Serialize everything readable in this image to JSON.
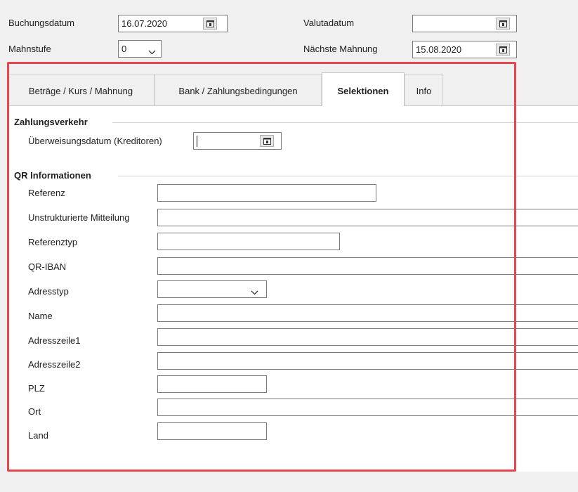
{
  "header": {
    "buchungsdatum_label": "Buchungsdatum",
    "buchungsdatum_value": "16.07.2020",
    "valutadatum_label": "Valutadatum",
    "valutadatum_value": "",
    "mahnstufe_label": "Mahnstufe",
    "mahnstufe_value": "0",
    "naechste_mahnung_label": "Nächste Mahnung",
    "naechste_mahnung_value": "15.08.2020"
  },
  "tabs": [
    {
      "label": "Beträge / Kurs / Mahnung",
      "active": false
    },
    {
      "label": "Bank / Zahlungsbedingungen",
      "active": false
    },
    {
      "label": "Selektionen",
      "active": true
    },
    {
      "label": "Info",
      "active": false
    }
  ],
  "zahlungsverkehr": {
    "title": "Zahlungsverkehr",
    "ueberweisungsdatum_label": "Überweisungsdatum (Kreditoren)",
    "ueberweisungsdatum_value": ""
  },
  "qr": {
    "title": "QR Informationen",
    "fields": [
      {
        "label": "Referenz",
        "value": ""
      },
      {
        "label": "Unstrukturierte Mitteilung",
        "value": ""
      },
      {
        "label": "Referenztyp",
        "value": ""
      },
      {
        "label": "QR-IBAN",
        "value": ""
      },
      {
        "label": "Adresstyp",
        "value": ""
      },
      {
        "label": "Name",
        "value": ""
      },
      {
        "label": "Adresszeile1",
        "value": ""
      },
      {
        "label": "Adresszeile2",
        "value": ""
      },
      {
        "label": "PLZ",
        "value": ""
      },
      {
        "label": "Ort",
        "value": ""
      },
      {
        "label": "Land",
        "value": ""
      }
    ]
  },
  "icons": {
    "calendar": "calendar-icon",
    "dropdown": "chevron-down-icon"
  },
  "colors": {
    "highlight_border": "#e8454f",
    "panel_background": "#ffffff",
    "window_background": "#f0f0f0"
  }
}
